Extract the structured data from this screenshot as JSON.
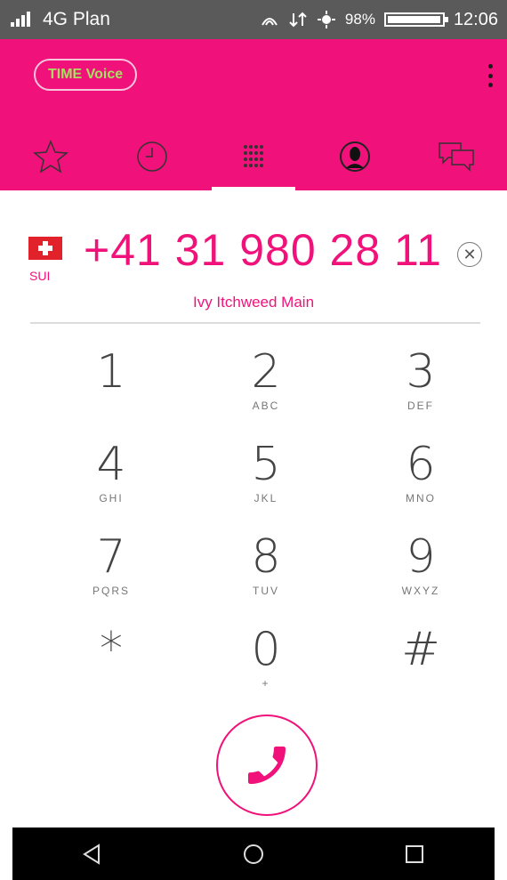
{
  "status_bar": {
    "carrier": "4G Plan",
    "battery": "98%",
    "battery_level": 0.98,
    "time": "12:06",
    "icons": [
      "signal-icon",
      "nfc-icon",
      "data-icon",
      "location-icon",
      "battery-icon"
    ]
  },
  "header": {
    "brand_label": "TIME Voice",
    "colors": {
      "accent": "#f0127a",
      "brand_text": "#a9e060"
    },
    "tabs": [
      {
        "name": "favorites",
        "icon": "star-icon",
        "active": false
      },
      {
        "name": "recents",
        "icon": "clock-icon",
        "active": false
      },
      {
        "name": "keypad",
        "icon": "dialpad-icon",
        "active": true
      },
      {
        "name": "contacts",
        "icon": "contact-icon",
        "active": false
      },
      {
        "name": "messages",
        "icon": "chat-icon",
        "active": false
      }
    ]
  },
  "dialer": {
    "country_code": "SUI",
    "phone_number": "+41 31 980 28 11",
    "contact_name": "Ivy Itchweed Main"
  },
  "keypad": {
    "keys": [
      {
        "digit": "1",
        "letters": ""
      },
      {
        "digit": "2",
        "letters": "ABC"
      },
      {
        "digit": "3",
        "letters": "DEF"
      },
      {
        "digit": "4",
        "letters": "GHI"
      },
      {
        "digit": "5",
        "letters": "JKL"
      },
      {
        "digit": "6",
        "letters": "MNO"
      },
      {
        "digit": "7",
        "letters": "PQRS"
      },
      {
        "digit": "8",
        "letters": "TUV"
      },
      {
        "digit": "9",
        "letters": "WXYZ"
      },
      {
        "digit": "*",
        "letters": ""
      },
      {
        "digit": "0",
        "letters": "+"
      },
      {
        "digit": "#",
        "letters": ""
      }
    ]
  },
  "nav_bar": {
    "icons": [
      "back-icon",
      "home-icon",
      "recents-icon"
    ]
  }
}
